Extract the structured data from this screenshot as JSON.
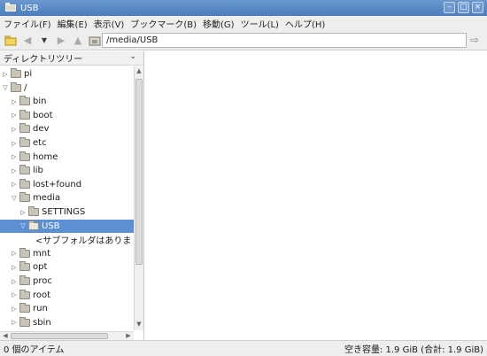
{
  "window": {
    "title": "USB"
  },
  "menu": [
    "ファイル(F)",
    "編集(E)",
    "表示(V)",
    "ブックマーク(B)",
    "移動(G)",
    "ツール(L)",
    "ヘルプ(H)"
  ],
  "toolbar": {
    "address": "/media/USB",
    "icons": [
      "new-folder-icon",
      "back-icon",
      "dropdown-icon",
      "forward-icon",
      "up-icon",
      "home-icon",
      "go-icon"
    ]
  },
  "sidebar": {
    "header": "ディレクトリツリー",
    "items": [
      {
        "label": "pi",
        "depth": 0,
        "expander": "▷"
      },
      {
        "label": "/",
        "depth": 0,
        "expander": "▽"
      },
      {
        "label": "bin",
        "depth": 1,
        "expander": "▷"
      },
      {
        "label": "boot",
        "depth": 1,
        "expander": "▷"
      },
      {
        "label": "dev",
        "depth": 1,
        "expander": "▷"
      },
      {
        "label": "etc",
        "depth": 1,
        "expander": "▷"
      },
      {
        "label": "home",
        "depth": 1,
        "expander": "▷"
      },
      {
        "label": "lib",
        "depth": 1,
        "expander": "▷"
      },
      {
        "label": "lost+found",
        "depth": 1,
        "expander": "▷"
      },
      {
        "label": "media",
        "depth": 1,
        "expander": "▽"
      },
      {
        "label": "SETTINGS",
        "depth": 2,
        "expander": "▷"
      },
      {
        "label": "USB",
        "depth": 2,
        "expander": "▽",
        "selected": true
      },
      {
        "label": "<サブフォルダはありま",
        "depth": 3,
        "expander": "",
        "placeholder": true
      },
      {
        "label": "mnt",
        "depth": 1,
        "expander": "▷"
      },
      {
        "label": "opt",
        "depth": 1,
        "expander": "▷"
      },
      {
        "label": "proc",
        "depth": 1,
        "expander": "▷"
      },
      {
        "label": "root",
        "depth": 1,
        "expander": "▷"
      },
      {
        "label": "run",
        "depth": 1,
        "expander": "▷"
      },
      {
        "label": "sbin",
        "depth": 1,
        "expander": "▷"
      }
    ]
  },
  "status": {
    "left": "0 個のアイテム",
    "right": "空き容量: 1.9 GiB (合計: 1.9 GiB)"
  },
  "colors": {
    "titlebar": "#4b7dbe",
    "selection": "#5d8fd3"
  }
}
